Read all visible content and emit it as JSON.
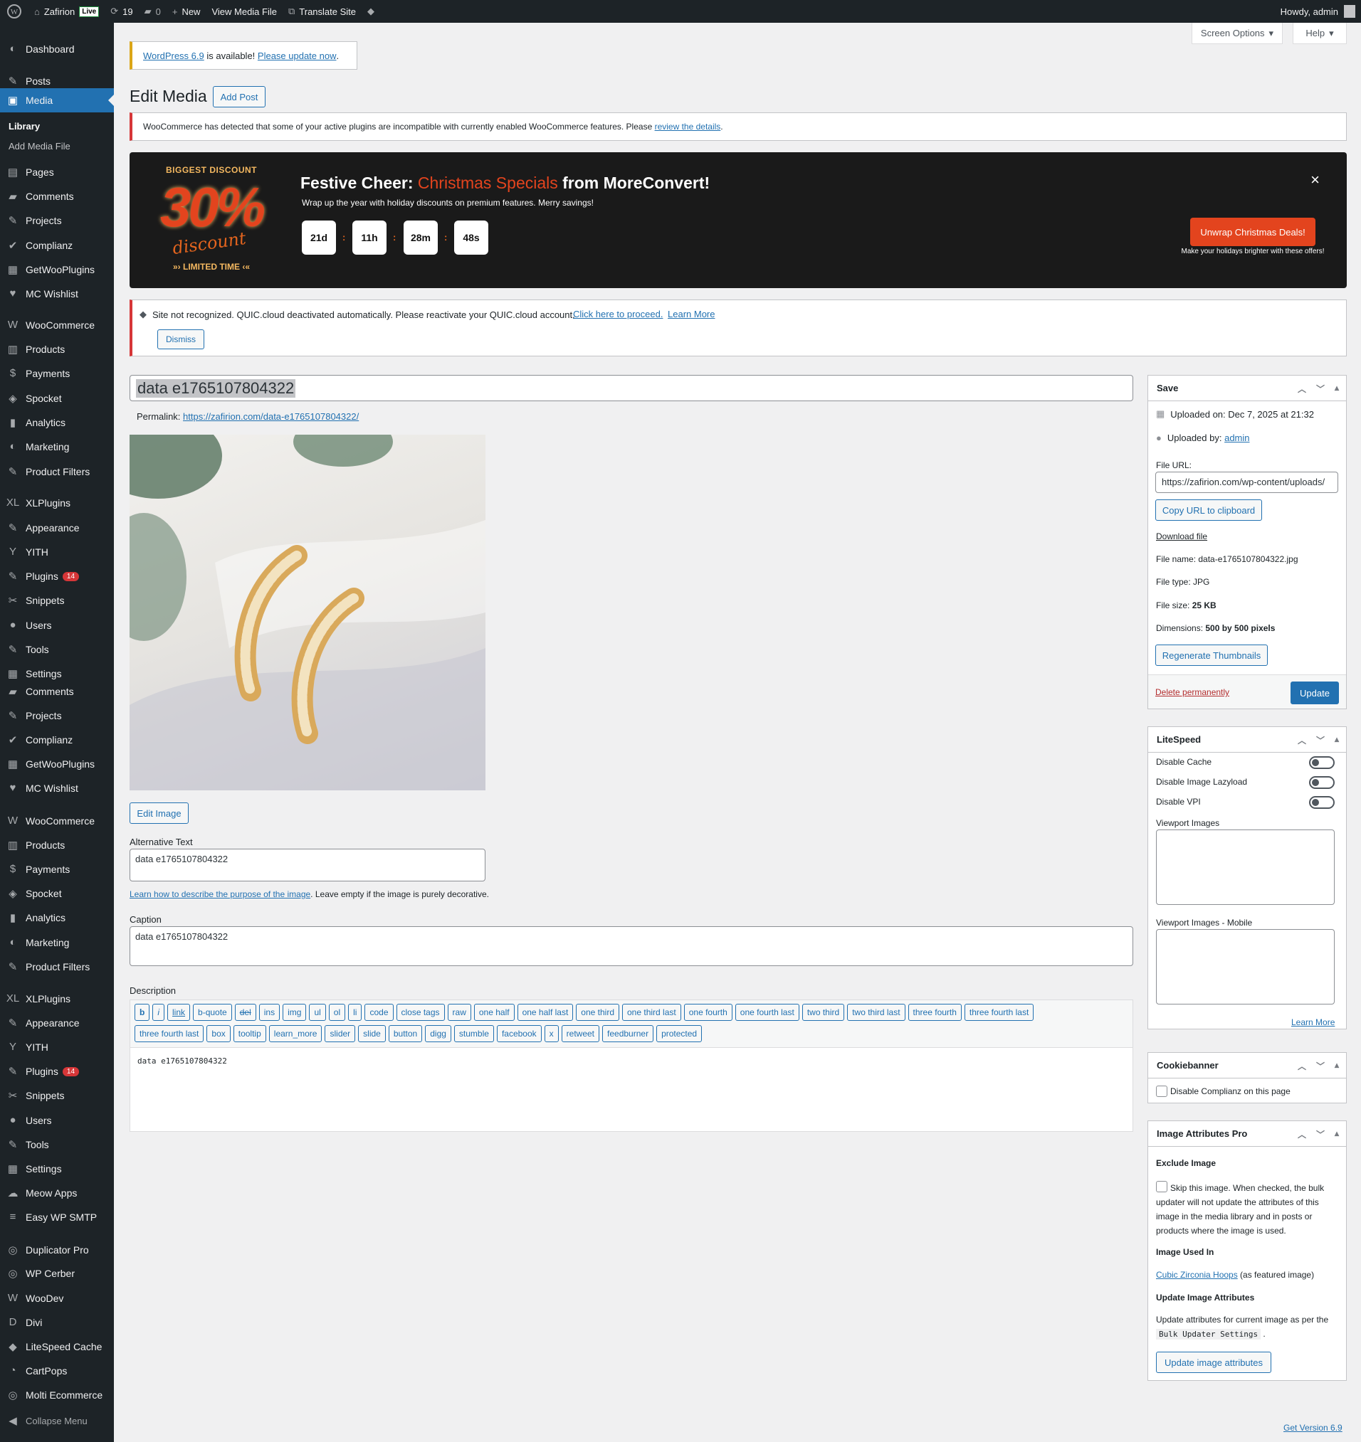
{
  "admin_bar": {
    "site_name": "Zafirion",
    "live_badge": "Live",
    "updates_count": "19",
    "comments_count": "0",
    "new_label": "New",
    "view_label": "View Media File",
    "translate_label": "Translate Site",
    "howdy": "Howdy, admin"
  },
  "menu": {
    "dashboard": "Dashboard",
    "posts": "Posts",
    "media": "Media",
    "library": "Library",
    "add_media": "Add Media File",
    "group1": [
      "Pages",
      "Comments",
      "Projects",
      "Complianz",
      "GetWooPlugins",
      "MC Wishlist"
    ],
    "group2": [
      "WooCommerce",
      "Products",
      "Payments",
      "Spocket",
      "Analytics",
      "Marketing",
      "Product Filters"
    ],
    "group3": [
      "XLPlugins",
      "Appearance",
      "YITH",
      "Plugins",
      "Snippets",
      "Users",
      "Tools",
      "Settings"
    ],
    "group4": [
      "Comments",
      "Projects",
      "Complianz",
      "GetWooPlugins",
      "MC Wishlist"
    ],
    "group5": [
      "WooCommerce",
      "Products",
      "Payments",
      "Spocket",
      "Analytics",
      "Marketing",
      "Product Filters"
    ],
    "group6": [
      "XLPlugins",
      "Appearance",
      "YITH",
      "Plugins",
      "Snippets",
      "Users",
      "Tools",
      "Settings",
      "Meow Apps",
      "Easy WP SMTP"
    ],
    "group7": [
      "Duplicator Pro",
      "WP Cerber",
      "WooDev",
      "Divi",
      "LiteSpeed Cache",
      "CartPops",
      "Molti Ecommerce"
    ],
    "plugins_badge": "14",
    "collapse": "Collapse Menu"
  },
  "screen_options": "Screen Options",
  "help": "Help",
  "update_notice": {
    "link1": "WordPress 6.9",
    "text": " is available! ",
    "link2": "Please update now",
    "end": "."
  },
  "page_title": "Edit Media",
  "add_post": "Add Post",
  "woo_notice": {
    "text": "WooCommerce has detected that some of your active plugins are incompatible with currently enabled WooCommerce features. Please ",
    "link": "review the details",
    "end": "."
  },
  "promo": {
    "biggest": "BIGGEST DISCOUNT",
    "percent": "30%",
    "discount_word": "discount",
    "limited": "LIMITED TIME",
    "headline_a": "Festive Cheer: ",
    "headline_b": "Christmas Specials",
    "headline_c": " from MoreConvert!",
    "subline": "Wrap up the year with holiday discounts on premium features. Merry savings!",
    "days": "21d",
    "hours": "11h",
    "minutes": "28m",
    "seconds": "48s",
    "cta": "Unwrap Christmas Deals!",
    "cta_sub": "Make your holidays brighter with these offers!",
    "close": "×"
  },
  "quic_notice": {
    "text": "Site not recognized. QUIC.cloud deactivated automatically. Please reactivate your QUIC.cloud account. ",
    "link1": "Click here to proceed.",
    "link2": "Learn More",
    "dismiss": "Dismiss"
  },
  "title_value": "data e1765107804322",
  "permalink_label": "Permalink: ",
  "permalink_url": "https://zafirion.com/data-e1765107804322/",
  "edit_image": "Edit Image",
  "alt_label": "Alternative Text",
  "alt_value": "data e1765107804322",
  "alt_help_link": "Learn how to describe the purpose of the image",
  "alt_help_text": ". Leave empty if the image is purely decorative.",
  "caption_label": "Caption",
  "caption_value": "data e1765107804322",
  "description_label": "Description",
  "quicktags_row1": [
    "b",
    "i",
    "link",
    "b-quote",
    "del",
    "ins",
    "img",
    "ul",
    "ol",
    "li",
    "code",
    "close tags",
    "raw",
    "one half",
    "one half last",
    "one third",
    "one third last",
    "one fourth",
    "one fourth last",
    "two third",
    "two third last",
    "three fourth",
    "three fourth last"
  ],
  "quicktags_row2": [
    "three fourth last",
    "box",
    "tooltip",
    "learn_more",
    "slider",
    "slide",
    "button",
    "digg",
    "stumble",
    "facebook",
    "x",
    "retweet",
    "feedburner",
    "protected"
  ],
  "description_value": "data e1765107804322",
  "save_box": {
    "title": "Save",
    "uploaded_on_label": "Uploaded on: ",
    "uploaded_on": "Dec 7, 2025 at 21:32",
    "uploaded_by_label": "Uploaded by: ",
    "uploaded_by": "admin",
    "file_url_label": "File URL:",
    "file_url": "https://zafirion.com/wp-content/uploads/",
    "copy_url": "Copy URL to clipboard",
    "download": "Download file",
    "file_name_label": "File name: ",
    "file_name": "data-e1765107804322.jpg",
    "file_type_label": "File type: ",
    "file_type": "JPG",
    "file_size_label": "File size: ",
    "file_size": "25 KB",
    "dimensions_label": "Dimensions: ",
    "dimensions": "500 by 500 pixels",
    "regenerate": "Regenerate Thumbnails",
    "delete": "Delete permanently",
    "update": "Update"
  },
  "litespeed": {
    "title": "LiteSpeed",
    "disable_cache": "Disable Cache",
    "disable_lazyload": "Disable Image Lazyload",
    "disable_vpi": "Disable VPI",
    "viewport": "Viewport Images",
    "viewport_mobile": "Viewport Images - Mobile",
    "learn_more": "Learn More"
  },
  "cookiebanner": {
    "title": "Cookiebanner",
    "disable": "Disable Complianz on this page"
  },
  "iap": {
    "title": "Image Attributes Pro",
    "exclude_title": "Exclude Image",
    "exclude_text": "Skip this image. When checked, the bulk updater will not update the attributes of this image in the media library and in posts or products where the image is used.",
    "used_in_title": "Image Used In",
    "used_in_link": "Cubic Zirconia Hoops",
    "used_in_suffix": " (as featured image)",
    "update_title": "Update Image Attributes",
    "update_text_a": "Update attributes for current image as per the ",
    "update_code": "Bulk Updater Settings",
    "update_text_b": " .",
    "update_btn": "Update image attributes"
  },
  "footer_version": "Get Version 6.9",
  "colors": {
    "accent": "#2271b1",
    "menu_bg": "#1d2327",
    "red": "#d63638",
    "promo_orange": "#e3441e"
  }
}
